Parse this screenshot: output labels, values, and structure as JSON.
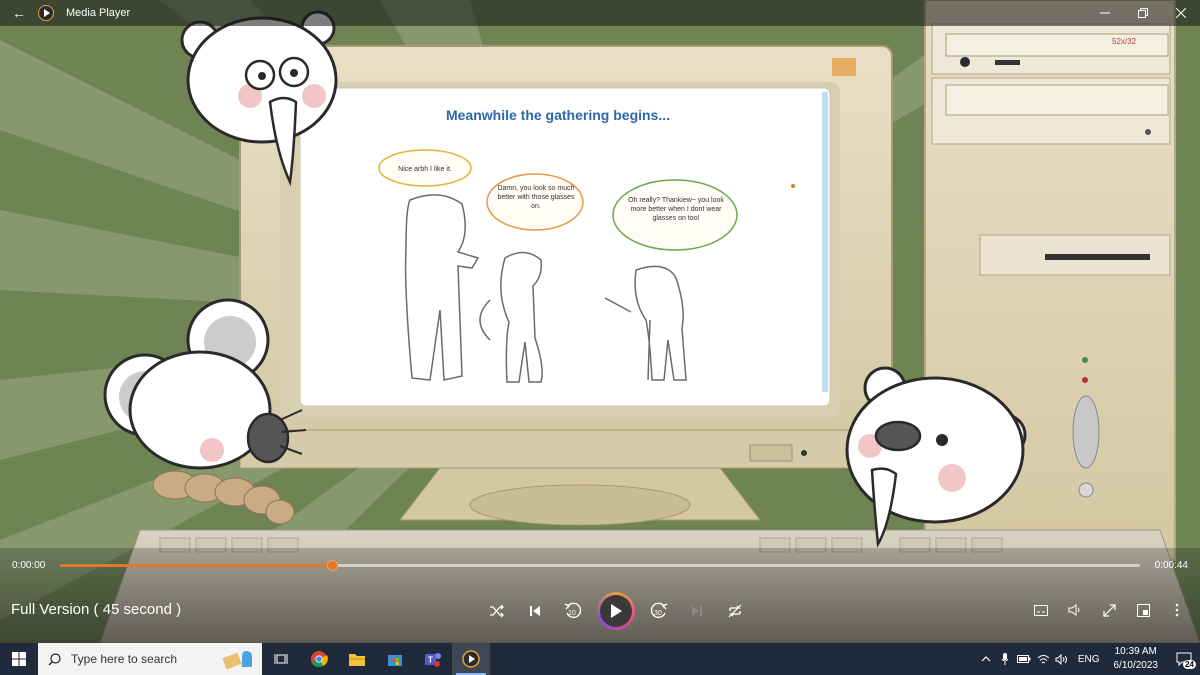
{
  "window": {
    "title": "Media Player"
  },
  "video": {
    "slide_title": "Meanwhile the gathering begins...",
    "bubble_1": "Nice arbh I like it.",
    "bubble_2": "Damn, you look so much better with those glasses on.",
    "bubble_3": "Oh really? Thankiew~ you look more better when I dont wear glasses on too!",
    "drive_label": "52x/32"
  },
  "player": {
    "time_elapsed": "0:00:00",
    "time_total": "0:00:44",
    "progress": 0.252,
    "video_title": "Full Version ( 45 second )",
    "skip_back_seconds": "10",
    "skip_forward_seconds": "30"
  },
  "taskbar": {
    "search_placeholder": "Type here to search",
    "lang": "ENG",
    "time": "10:39 AM",
    "date": "6/10/2023",
    "notification_count": "24"
  },
  "colors": {
    "accent": "#e07a2a",
    "taskbar_bg": "#1f2b3a",
    "scene_green": "#6f8456"
  }
}
